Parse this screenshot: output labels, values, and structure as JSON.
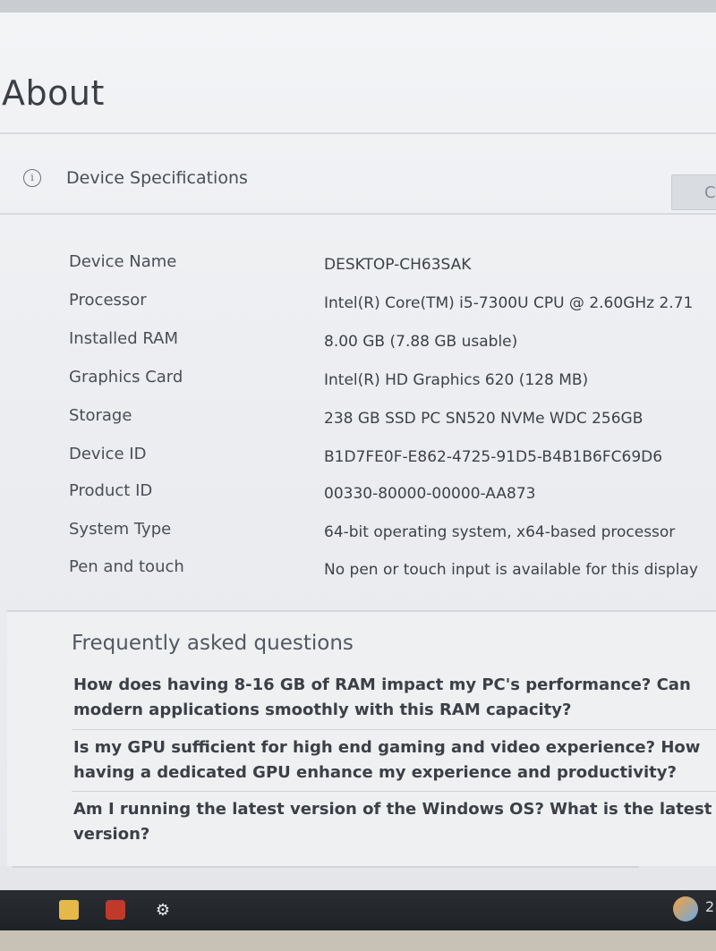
{
  "page": {
    "title": "About"
  },
  "specs_section": {
    "label": "Device Specifications",
    "copy_button_label": "C",
    "rows": [
      {
        "key": "Device Name",
        "value": "DESKTOP-CH63SAK"
      },
      {
        "key": "Processor",
        "value": "Intel(R) Core(TM) i5-7300U CPU @ 2.60GHz   2.71"
      },
      {
        "key": "Installed RAM",
        "value": "8.00 GB (7.88 GB usable)"
      },
      {
        "key": "Graphics Card",
        "value": "Intel(R) HD Graphics 620 (128 MB)"
      },
      {
        "key": "Storage",
        "value": "238 GB SSD PC SN520 NVMe WDC 256GB"
      },
      {
        "key": "Device ID",
        "value": "B1D7FE0F-E862-4725-91D5-B4B1B6FC69D6"
      },
      {
        "key": "Product ID",
        "value": "00330-80000-00000-AA873"
      },
      {
        "key": "System Type",
        "value": "64-bit operating system, x64-based processor"
      },
      {
        "key": "Pen and touch",
        "value": "No pen or touch input is available for this display"
      }
    ]
  },
  "faq": {
    "title": "Frequently asked questions",
    "items": [
      {
        "line1": "How does having 8-16 GB of RAM impact my PC's performance? Can",
        "line2": "modern applications smoothly with this RAM capacity?"
      },
      {
        "line1": "Is my GPU sufficient for high end gaming and video experience? How",
        "line2": "having a dedicated GPU enhance my experience and productivity?"
      },
      {
        "line1": "Am I running the latest version of the Windows OS? What is the latest Winc",
        "line2": "version?"
      }
    ]
  },
  "taskbar": {
    "icons": [
      "file-explorer-icon",
      "mail-icon",
      "settings-gear-icon",
      "tray-app-icon"
    ],
    "clock": "2"
  },
  "colors": {
    "background": "#eceef1",
    "taskbar": "#1f2226",
    "text": "#3a3f45"
  }
}
